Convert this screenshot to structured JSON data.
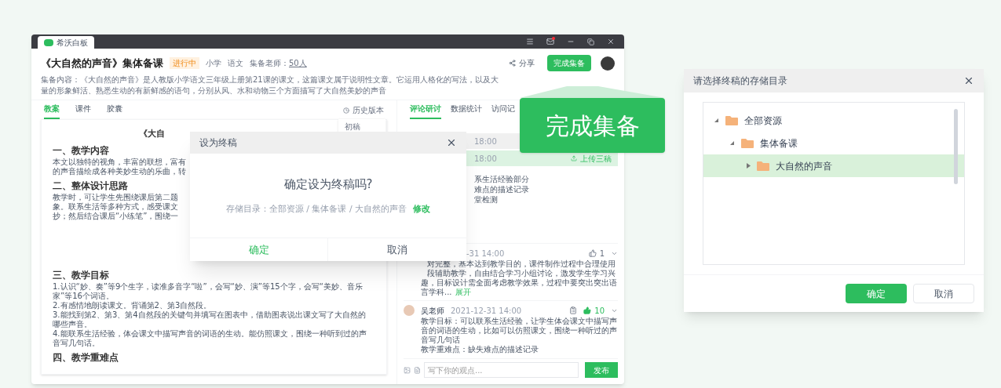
{
  "app": {
    "name": "希沃白板"
  },
  "header": {
    "title": "《大自然的声音》集体备课",
    "status": {
      "label": "进行中",
      "kind": "active"
    },
    "tags": [
      "小学",
      "语文"
    ],
    "teachers_label": "集备老师：",
    "teachers_count": "50人",
    "share": "分享",
    "finish_button": "完成集备",
    "description": "集备内容：《大自然的声音》是人教版小学语文三年级上册第21课的课文，这篇课文属于说明性文章。它运用人格化的写法，以及大量的形象鲜活、熟悉生动的有新鲜感的语句，分别从风、水和动物三个方面描写了大自然美妙的声音"
  },
  "left_panel": {
    "tabs": [
      {
        "label": "教案",
        "selected": true
      },
      {
        "label": "课件",
        "selected": false
      },
      {
        "label": "胶囊",
        "selected": false
      }
    ],
    "history": "历史版本",
    "version_menu": [
      "初稿"
    ],
    "document": {
      "title": "《大自",
      "sections": [
        {
          "heading": "一、教学内容",
          "lines": [
            "本文以独特的视角，丰富的联想，富有",
            "的声音描绘成各种美妙生动的乐曲，转"
          ]
        },
        {
          "heading": "二、整体设计思路",
          "lines": [
            "教学时，可让学生先围绕课后第二题",
            "象。联系生活等多种方式，感受课文",
            "抄；然后结合课后“小练笔”，围绕一"
          ]
        },
        {
          "heading": "三、教学目标",
          "lines": [
            "1.认识“妙、奏”等9个生字，读准多音字“啦”，会写“妙、演”等15个字，会写“美妙、音乐家”等16个词语。",
            "2.有感情地朗读课文。背诵第2、第3自然段。",
            "3.能找到第2、第3、第4自然段的关键句并填写在图表中，借助图表说出课文写了大自然的哪些声音。",
            "4.能联系生活经验，体会课文中描写声音的词语的生动。能仿照课文，围绕一种听到过的声音写几句话。"
          ]
        },
        {
          "heading": "四、教学重难点"
        }
      ]
    }
  },
  "right_panel": {
    "tabs": [
      {
        "label": "评论研讨",
        "selected": true
      },
      {
        "label": "数据统计",
        "selected": false
      },
      {
        "label": "访问记",
        "selected": false
      }
    ],
    "records": [
      {
        "time": "18:00",
        "highlighted": false
      },
      {
        "time": "18:00",
        "highlighted": true,
        "action": "上传三稿"
      }
    ],
    "notes": [
      "系生活经验部分",
      "难点的描述记录",
      "堂检测"
    ],
    "comments": [
      {
        "time": "-31 14:00",
        "liked": false,
        "likes": "1",
        "deletable": false,
        "covered_lines": [
          "对完整，基本达到教学目的，课件制作过程中合理使用",
          "段辅助教学，自由结合学习小组讨论，激发学生学习兴"
        ],
        "lines": [
          "趣，目标设计需全面考虑教学效果，过程中要突出突出语言学科..."
        ],
        "more": "展开"
      },
      {
        "author": "吴老师",
        "time": "2021-12-31 14:00",
        "liked": true,
        "likes": "10",
        "deletable": true,
        "lines": [
          "教学目标：可以联系生活经验，让学生体会课文中描写声音的词语的生动，比如可以仿照课文，围绕一种听过的声音写几句话",
          "教学重难点：缺失难点的描述记录"
        ]
      }
    ],
    "input": {
      "placeholder": "写下你的观点...",
      "button": "发布"
    }
  },
  "dialog": {
    "title": "设为终稿",
    "question": "确定设为终稿吗?",
    "path_label": "存储目录：",
    "path": "全部资源 / 集体备课 / 大自然的声音",
    "change": "修改",
    "confirm": "确定",
    "cancel": "取消"
  },
  "callout": {
    "label": "完成集备"
  },
  "folder_dialog": {
    "title": "请选择终稿的存储目录",
    "tree": [
      {
        "label": "全部资源",
        "expanded": true,
        "selected": false,
        "children": [
          {
            "label": "集体备课",
            "expanded": true,
            "selected": false,
            "children": [
              {
                "label": "大自然的声音",
                "expanded": false,
                "selected": true
              }
            ]
          }
        ]
      }
    ],
    "confirm": "确定",
    "cancel": "取消"
  }
}
